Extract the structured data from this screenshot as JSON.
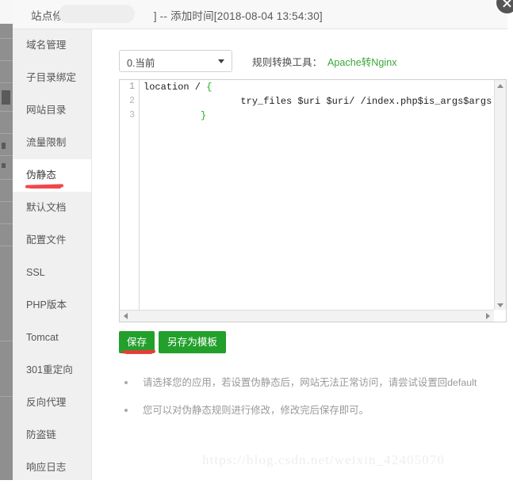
{
  "window": {
    "title_prefix": "站点修改[",
    "title_suffix": "] -- 添加时间[2018-08-04 13:54:30]",
    "close_label": "×"
  },
  "sidebar": {
    "items": [
      {
        "label": "域名管理",
        "active": false
      },
      {
        "label": "子目录绑定",
        "active": false
      },
      {
        "label": "网站目录",
        "active": false
      },
      {
        "label": "流量限制",
        "active": false
      },
      {
        "label": "伪静态",
        "active": true
      },
      {
        "label": "默认文档",
        "active": false
      },
      {
        "label": "配置文件",
        "active": false
      },
      {
        "label": "SSL",
        "active": false
      },
      {
        "label": "PHP版本",
        "active": false
      },
      {
        "label": "Tomcat",
        "active": false
      },
      {
        "label": "301重定向",
        "active": false
      },
      {
        "label": "反向代理",
        "active": false
      },
      {
        "label": "防盗链",
        "active": false
      },
      {
        "label": "响应日志",
        "active": false
      }
    ]
  },
  "toolbar": {
    "select_value": "0.当前",
    "converter_label": "规则转换工具：",
    "converter_link": "Apache转Nginx"
  },
  "editor": {
    "line_numbers": [
      "1",
      "2",
      "3"
    ],
    "lines": [
      {
        "pre": "location / ",
        "brace": "{",
        "post": ""
      },
      {
        "pre": "                 try_files $uri $uri/ /index.php$is_args$args;",
        "brace": "",
        "post": ""
      },
      {
        "pre": "          ",
        "brace": "}",
        "post": ""
      }
    ]
  },
  "buttons": {
    "save_label": "保存",
    "save_as_template_label": "另存为模板"
  },
  "notes": [
    "请选择您的应用，若设置伪静态后，网站无法正常访问，请尝试设置回default",
    "您可以对伪静态规则进行修改，修改完后保存即可。"
  ],
  "watermark": "https://blog.csdn.net/weixin_42405070",
  "colors": {
    "accent_green": "#22a02b",
    "link_green": "#3aa63a",
    "annotation_red": "#f0383c",
    "sidebar_bg": "#f0f0f0"
  }
}
